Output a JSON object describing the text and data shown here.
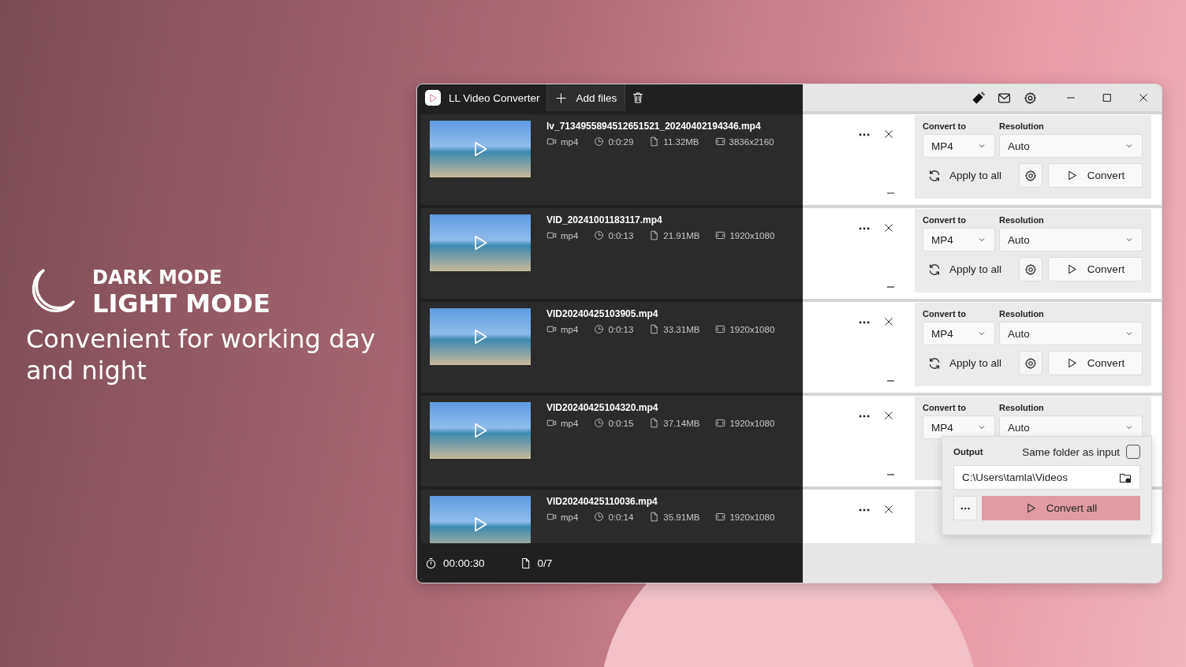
{
  "promo": {
    "title_small": "DARK MODE",
    "title_large": "LIGHT MODE",
    "tagline": "Convenient for working day and night"
  },
  "window": {
    "title": "LL Video Converter",
    "add_files": "Add files"
  },
  "files": [
    {
      "name": "lv_7134955894512651521_20240402194346.mp4",
      "format": "mp4",
      "duration": "0:0:29",
      "size": "11.32MB",
      "dimensions": "3836x2160",
      "settings": {
        "convert_to_label": "Convert to",
        "resolution_label": "Resolution",
        "format": "MP4",
        "resolution": "Auto",
        "apply_all": "Apply to all",
        "convert": "Convert"
      }
    },
    {
      "name": "VID_20241001183117.mp4",
      "format": "mp4",
      "duration": "0:0:13",
      "size": "21.91MB",
      "dimensions": "1920x1080",
      "settings": {
        "convert_to_label": "Convert to",
        "resolution_label": "Resolution",
        "format": "MP4",
        "resolution": "Auto",
        "apply_all": "Apply to all",
        "convert": "Convert"
      }
    },
    {
      "name": "VID20240425103905.mp4",
      "format": "mp4",
      "duration": "0:0:13",
      "size": "33.31MB",
      "dimensions": "1920x1080",
      "settings": {
        "convert_to_label": "Convert to",
        "resolution_label": "Resolution",
        "format": "MP4",
        "resolution": "Auto",
        "apply_all": "Apply to all",
        "convert": "Convert"
      }
    },
    {
      "name": "VID20240425104320.mp4",
      "format": "mp4",
      "duration": "0:0:15",
      "size": "37.14MB",
      "dimensions": "1920x1080",
      "settings": {
        "convert_to_label": "Convert to",
        "resolution_label": "Resolution",
        "format": "MP4",
        "resolution": "Auto"
      }
    },
    {
      "name": "VID20240425110036.mp4",
      "format": "mp4",
      "duration": "0:0:14",
      "size": "35.91MB",
      "dimensions": "1920x1080"
    }
  ],
  "status_bar": {
    "elapsed": "00:00:30",
    "progress": "0/7"
  },
  "output": {
    "label": "Output",
    "same_folder_label": "Same folder as input",
    "same_folder_checked": false,
    "path": "C:\\Users\\tamla\\Videos",
    "convert_all": "Convert all"
  }
}
